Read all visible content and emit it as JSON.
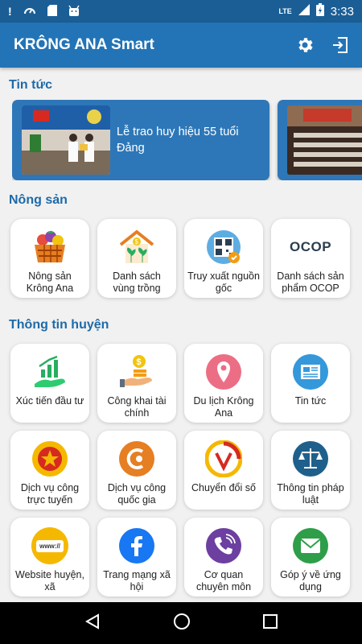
{
  "status": {
    "time": "3:33",
    "network": "LTE"
  },
  "app": {
    "title": "KRÔNG ANA Smart"
  },
  "sections": {
    "news": "Tin tức",
    "agriculture": "Nông sản",
    "district": "Thông tin huyện"
  },
  "news": [
    {
      "title": "Lễ trao huy hiệu 55 tuổi Đảng"
    }
  ],
  "agriculture": [
    {
      "label": "Nông sản Krông Ana",
      "icon": "fruit-basket-icon"
    },
    {
      "label": "Danh sách vùng trồng",
      "icon": "plant-house-icon"
    },
    {
      "label": "Truy xuất nguồn gốc",
      "icon": "qr-trace-icon"
    },
    {
      "label": "Danh sách sản phẩm OCOP",
      "icon": "ocop-logo-icon",
      "logo_text": "OCOP"
    }
  ],
  "district": [
    {
      "label": "Xúc tiến đầu tư",
      "icon": "investment-growth-icon"
    },
    {
      "label": "Công khai tài chính",
      "icon": "coin-hand-icon"
    },
    {
      "label": "Du lịch Krông Ana",
      "icon": "location-pin-icon"
    },
    {
      "label": "Tin tức",
      "icon": "newspaper-icon"
    },
    {
      "label": "Dịch vụ công trực tuyến",
      "icon": "online-public-service-icon"
    },
    {
      "label": "Dịch vụ công quốc gia",
      "icon": "national-public-service-icon"
    },
    {
      "label": "Chuyển đổi số",
      "icon": "digital-transformation-icon"
    },
    {
      "label": "Thông tin pháp luật",
      "icon": "scales-icon"
    },
    {
      "label": "Website huyện, xã",
      "icon": "www-icon",
      "logo_text": "www://"
    },
    {
      "label": "Trang mạng xã hội",
      "icon": "facebook-icon"
    },
    {
      "label": "Cơ quan chuyên môn",
      "icon": "phone-call-icon"
    },
    {
      "label": "Góp ý về ứng dụng",
      "icon": "mail-icon"
    }
  ]
}
